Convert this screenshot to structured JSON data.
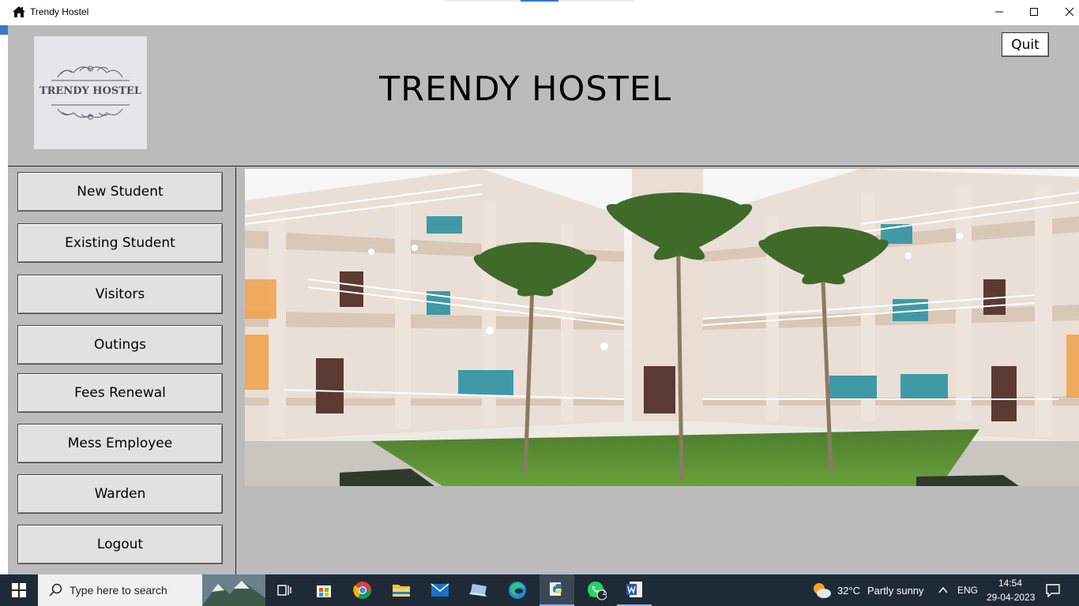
{
  "window": {
    "title": "Trendy Hostel",
    "icon": "home-icon",
    "controls": [
      "minimize-icon",
      "maximize-icon",
      "close-icon"
    ]
  },
  "header": {
    "logo_text": "TRENDY HOSTEL",
    "title": "TRENDY HOSTEL",
    "quit_label": "Quit"
  },
  "sidebar": {
    "items": [
      {
        "label": "New Student"
      },
      {
        "label": "Existing Student"
      },
      {
        "label": "Visitors"
      },
      {
        "label": "Outings"
      },
      {
        "label": "Fees Renewal"
      },
      {
        "label": "Mess Employee"
      },
      {
        "label": "Warden"
      },
      {
        "label": "Logout"
      }
    ]
  },
  "main": {
    "image": "hostel-courtyard-photo"
  },
  "taskbar": {
    "search_placeholder": "Type here to search",
    "apps": [
      "task-view-icon",
      "store-icon",
      "chrome-icon",
      "file-explorer-icon",
      "mail-icon",
      "laptop-icon",
      "edge-icon",
      "python-icon",
      "whatsapp-icon",
      "word-icon"
    ],
    "whatsapp_badge": "1",
    "weather": {
      "temp": "32°C",
      "condition": "Partly sunny"
    },
    "language": "ENG",
    "time": "14:54",
    "date": "29-04-2023"
  },
  "colors": {
    "app_background": "#bbbbbb",
    "button_face": "#e1e1e1",
    "taskbar": "#1f2a37"
  }
}
